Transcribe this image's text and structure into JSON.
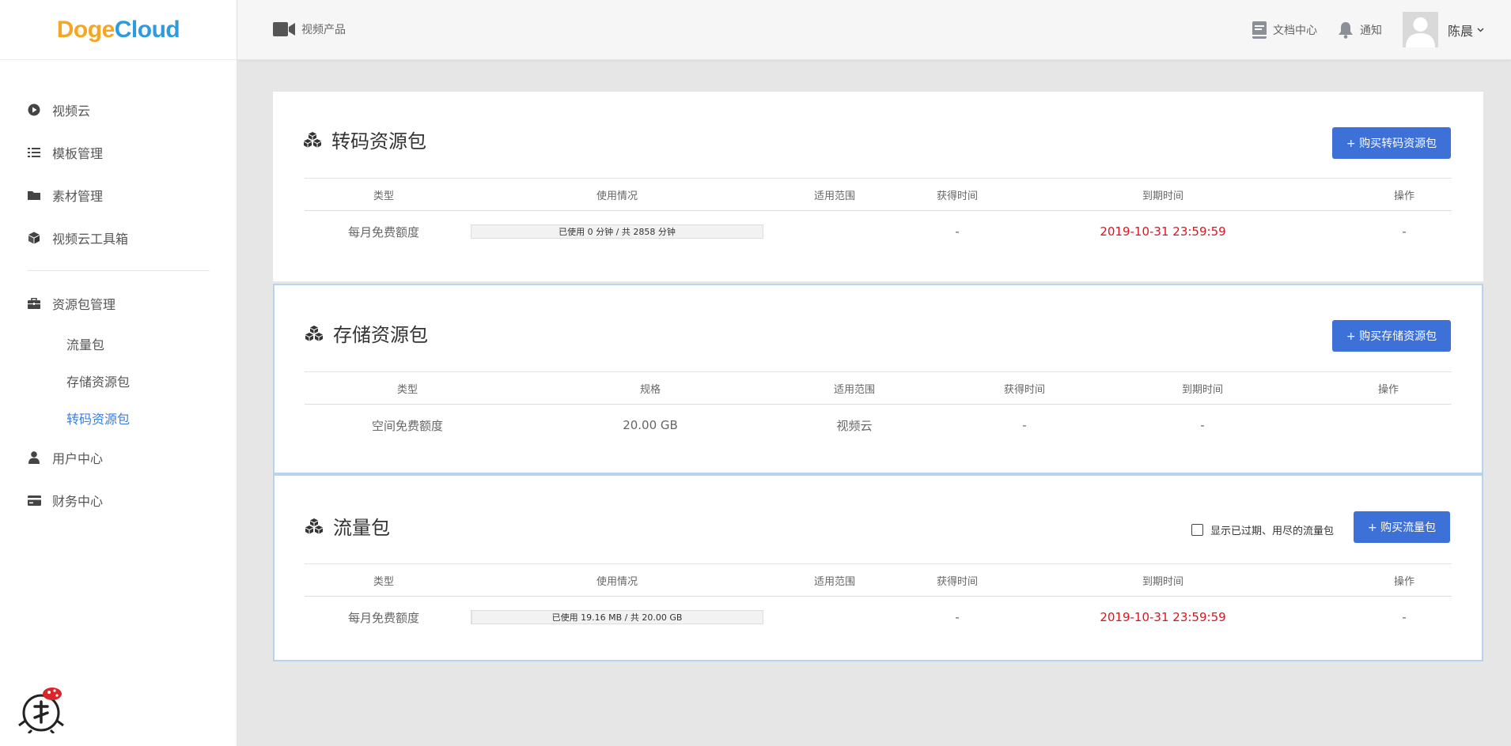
{
  "logo": {
    "part1": "Doge",
    "part2": "Cloud"
  },
  "sidebar": {
    "items": [
      {
        "label": "视频云",
        "icon": "play-circle-icon"
      },
      {
        "label": "模板管理",
        "icon": "list-icon"
      },
      {
        "label": "素材管理",
        "icon": "folder-icon"
      },
      {
        "label": "视频云工具箱",
        "icon": "cube-icon"
      }
    ],
    "group": {
      "label": "资源包管理",
      "icon": "briefcase-icon"
    },
    "subitems": [
      {
        "label": "流量包"
      },
      {
        "label": "存储资源包"
      },
      {
        "label": "转码资源包",
        "active": true
      }
    ],
    "bottom_items": [
      {
        "label": "用户中心",
        "icon": "user-icon"
      },
      {
        "label": "财务中心",
        "icon": "credit-card-icon"
      }
    ]
  },
  "topbar": {
    "product_label": "视频产品",
    "docs_label": "文档中心",
    "notify_label": "通知",
    "user_name": "陈晨"
  },
  "transcode": {
    "title": "转码资源包",
    "button": "+ 购买转码资源包",
    "headers": [
      "类型",
      "使用情况",
      "适用范围",
      "获得时间",
      "到期时间",
      "操作"
    ],
    "row": {
      "type": "每月免费额度",
      "usage": "已使用 0 分钟 / 共 2858 分钟",
      "usage_fraction": 0,
      "scope": "",
      "obtained": "-",
      "expires": "2019-10-31 23:59:59",
      "action": "-"
    }
  },
  "storage": {
    "title": "存储资源包",
    "button": "+ 购买存储资源包",
    "headers": [
      "类型",
      "规格",
      "适用范围",
      "获得时间",
      "到期时间",
      "操作"
    ],
    "row": {
      "type": "空间免费额度",
      "spec": "20.00 GB",
      "scope": "视频云",
      "obtained": "-",
      "expires": "-",
      "action": ""
    }
  },
  "traffic": {
    "title": "流量包",
    "checkbox_label": "显示已过期、用尽的流量包",
    "button": "+ 购买流量包",
    "headers": [
      "类型",
      "使用情况",
      "适用范围",
      "获得时间",
      "到期时间",
      "操作"
    ],
    "row": {
      "type": "每月免费额度",
      "usage": "已使用 19.16 MB / 共 20.00 GB",
      "usage_fraction": 0.001,
      "scope": "",
      "obtained": "-",
      "expires": "2019-10-31 23:59:59",
      "action": "-"
    }
  },
  "colors": {
    "accent": "#3d71d8",
    "active_link": "#3b7de0",
    "expiry": "#e3101c",
    "logo_orange": "#f5a623",
    "logo_blue": "#2e9bdc"
  }
}
